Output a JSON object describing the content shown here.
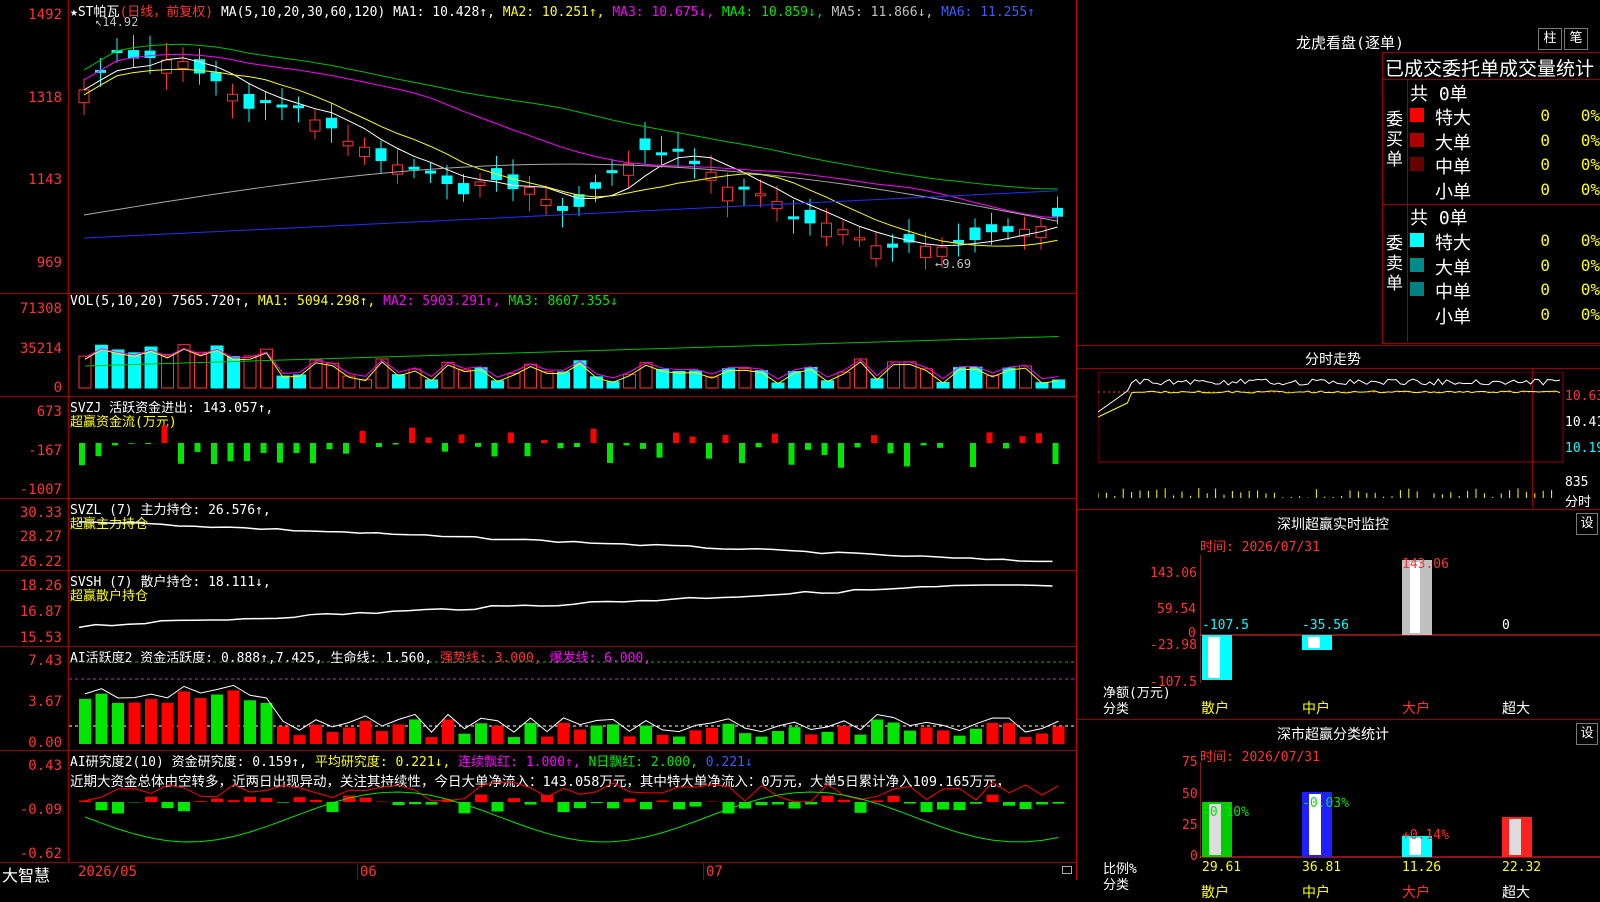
{
  "main_chart": {
    "title_star": "★",
    "stock_name": "ST帕瓦",
    "mode": "(日线，前复权)",
    "ma_params": "MA(5,10,20,30,60,120)",
    "ma1": "MA1: 10.428↑,",
    "ma2": "MA2: 10.251↑,",
    "ma3": "MA3: 10.675↓,",
    "ma4": "MA4: 10.859↓,",
    "ma5": "MA5: 11.866↓,",
    "ma6": "MA6: 11.255↑",
    "high_label": "14.92",
    "low_label": "←9.69",
    "y_ticks": [
      "1492",
      "1318",
      "1143",
      "969"
    ]
  },
  "vol_panel": {
    "label": "VOL(5,10,20)",
    "value": "7565.720↑,",
    "ma1": "MA1: 5094.298↑,",
    "ma2": "MA2: 5903.291↑,",
    "ma3": "MA3: 8607.355↓",
    "y_ticks": [
      "71308",
      "35214",
      "0"
    ]
  },
  "svzj_panel": {
    "label": "SVZJ  活跃资金进出: 143.057↑,",
    "sublabel": "超赢资金流(万元)",
    "y_ticks": [
      "673",
      "-167",
      "-1007"
    ]
  },
  "svzl_panel": {
    "label": "SVZL (7) 主力持仓: 26.576↑,",
    "sublabel": "超赢主力持仓",
    "y_ticks": [
      "30.33",
      "28.27",
      "26.22"
    ]
  },
  "svsh_panel": {
    "label": "SVSH (7) 散户持仓: 18.111↓,",
    "sublabel": "超赢散户持仓",
    "y_ticks": [
      "18.26",
      "16.87",
      "15.53"
    ]
  },
  "ai_active_panel": {
    "label_a": "AI活跃度2 资金活跃度: 0.888↑,7.425,",
    "label_b": "生命线: 1.560,",
    "label_c": "强势线: 3.000,",
    "label_d": "爆发线: 6.000,",
    "y_ticks": [
      "7.43",
      "3.67",
      "0.00"
    ]
  },
  "ai_research_panel": {
    "label_a": "AI研究度2(10) 资金研究度: 0.159↑,",
    "label_b": "平均研究度: 0.221↓,",
    "label_c": "连续飘红: 1.000↑,",
    "label_d": "N日飘红: 2.000,",
    "label_e": "0.221↓",
    "description": "近期大资金总体由空转多，近两日出现异动，关注其持续性，今日大单净流入：143.058万元，其中特大单净流入：0万元，大单5日累计净入109.165万元，",
    "y_ticks": [
      "0.43",
      "-0.09",
      "-0.62"
    ]
  },
  "bottom_bar": {
    "brand": "大智慧",
    "date_label": "2026/05",
    "month_6": "06",
    "month_7": "07"
  },
  "right_panel": {
    "top_title": "龙虎看盘(逐单)",
    "btn_column": "柱",
    "btn_pen": "笔",
    "stats_title": "已成交委托单成交量统计",
    "buy_side": {
      "header": "共 0单",
      "side_label": "委买单",
      "rows": [
        {
          "label": "特大",
          "count": "0",
          "pct": "0%",
          "color": "#ff0000"
        },
        {
          "label": "大单",
          "count": "0",
          "pct": "0%",
          "color": "#aa0000"
        },
        {
          "label": "中单",
          "count": "0",
          "pct": "0%",
          "color": "#660000"
        },
        {
          "label": "小单",
          "count": "0",
          "pct": "0%",
          "color": "#000000"
        }
      ]
    },
    "sell_side": {
      "header": "共 0单",
      "side_label": "委卖单",
      "rows": [
        {
          "label": "特大",
          "count": "0",
          "pct": "0%",
          "color": "#00ffff"
        },
        {
          "label": "大单",
          "count": "0",
          "pct": "0%",
          "color": "#008b8b"
        },
        {
          "label": "中单",
          "count": "0",
          "pct": "0%",
          "color": "#008080"
        },
        {
          "label": "小单",
          "count": "0",
          "pct": "0%",
          "color": "#000000"
        }
      ]
    },
    "intraday_title": "分时走势",
    "intraday_y": [
      "10.63",
      "10.41",
      "10.19"
    ],
    "intraday_vol": "835",
    "intraday_bottom": "分时",
    "sz_monitor": {
      "title": "深圳超赢实时监控",
      "btn": "设",
      "time": "时间: 2026/07/31",
      "y_ticks": [
        "143.06",
        "59.54",
        "0",
        "-23.98",
        "-107.5"
      ],
      "bar_values": [
        "-107.5",
        "-35.56",
        "143.06",
        "0"
      ],
      "side_label_1": "净额(万元)",
      "side_label_2": "分类",
      "categories": [
        "散户",
        "中户",
        "大户",
        "超大"
      ]
    },
    "sz_stats": {
      "title": "深市超赢分类统计",
      "btn": "设",
      "time": "时间: 2026/07/31",
      "y_ticks": [
        "75",
        "50",
        "25",
        "0"
      ],
      "changes": [
        "-0.10%",
        "-0.03%",
        "+0.14%"
      ],
      "values": [
        "29.61",
        "36.81",
        "11.26",
        "22.32"
      ],
      "side_label_1": "比例%",
      "side_label_2": "分类",
      "categories": [
        "散户",
        "中户",
        "大户",
        "超大"
      ]
    }
  },
  "colors": {
    "up": "#ff3232",
    "down": "#00ffff",
    "grid": "#9b0000",
    "background": "#000000"
  },
  "chart_data": {
    "type": "line",
    "title": "ST帕瓦",
    "ylim": [
      9.69,
      14.92
    ]
  }
}
